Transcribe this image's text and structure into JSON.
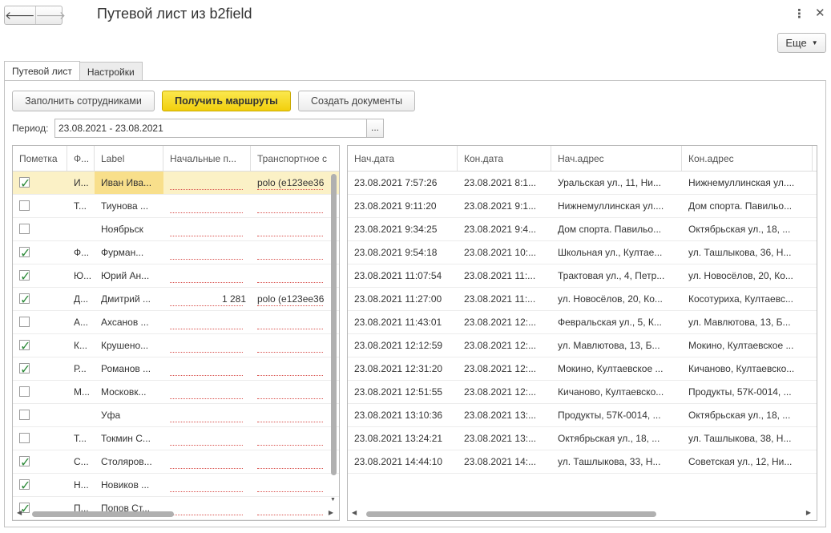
{
  "header": {
    "back_icon": "arrow-left-icon",
    "forward_icon": "arrow-right-icon",
    "title": "Путевой лист из b2field",
    "more_label": "Еще"
  },
  "tabs": [
    {
      "label": "Путевой лист",
      "active": true
    },
    {
      "label": "Настройки",
      "active": false
    }
  ],
  "toolbar": {
    "fill_employees": "Заполнить сотрудниками",
    "get_routes": "Получить маршруты",
    "create_documents": "Создать документы"
  },
  "period": {
    "label": "Период:",
    "value": "23.08.2021 - 23.08.2021",
    "select_label": "..."
  },
  "left_table": {
    "columns": [
      "Пометка",
      "Ф...",
      "Label",
      "Начальные п...",
      "Транспортное с"
    ],
    "rows": [
      {
        "checked": true,
        "f": "И...",
        "label": "Иван Ива...",
        "initial": "",
        "transport": "polo (e123ee36"
      },
      {
        "checked": false,
        "f": "Т...",
        "label": "Тиунова ...",
        "initial": "",
        "transport": ""
      },
      {
        "checked": false,
        "f": "",
        "label": "Ноябрьск",
        "initial": "",
        "transport": ""
      },
      {
        "checked": true,
        "f": "Ф...",
        "label": "Фурман...",
        "initial": "",
        "transport": ""
      },
      {
        "checked": true,
        "f": "Ю...",
        "label": "Юрий Ан...",
        "initial": "",
        "transport": ""
      },
      {
        "checked": true,
        "f": "Д...",
        "label": "Дмитрий ...",
        "initial": "1 281",
        "transport": "polo (e123ee36"
      },
      {
        "checked": false,
        "f": "А...",
        "label": "Ахсанов ...",
        "initial": "",
        "transport": ""
      },
      {
        "checked": true,
        "f": "К...",
        "label": "Крушено...",
        "initial": "",
        "transport": ""
      },
      {
        "checked": true,
        "f": "Р...",
        "label": "Романов ...",
        "initial": "",
        "transport": ""
      },
      {
        "checked": false,
        "f": "М...",
        "label": "Московк...",
        "initial": "",
        "transport": ""
      },
      {
        "checked": false,
        "f": "",
        "label": "Уфа",
        "initial": "",
        "transport": ""
      },
      {
        "checked": false,
        "f": "Т...",
        "label": "Токмин С...",
        "initial": "",
        "transport": ""
      },
      {
        "checked": true,
        "f": "С...",
        "label": "Столяров...",
        "initial": "",
        "transport": ""
      },
      {
        "checked": true,
        "f": "Н...",
        "label": "Новиков ...",
        "initial": "",
        "transport": ""
      },
      {
        "checked": true,
        "f": "П...",
        "label": "Попов Ст...",
        "initial": "",
        "transport": ""
      }
    ]
  },
  "right_table": {
    "columns": [
      "Нач.дата",
      "Кон.дата",
      "Нач.адрес",
      "Кон.адрес"
    ],
    "rows": [
      [
        "23.08.2021 7:57:26",
        "23.08.2021 8:1...",
        "Уральская ул., 11, Ни...",
        "Нижнемуллинская ул...."
      ],
      [
        "23.08.2021 9:11:20",
        "23.08.2021 9:1...",
        "Нижнемуллинская ул....",
        "Дом спорта. Павильо..."
      ],
      [
        "23.08.2021 9:34:25",
        "23.08.2021 9:4...",
        "Дом спорта. Павильо...",
        "Октябрьская ул., 18, ..."
      ],
      [
        "23.08.2021 9:54:18",
        "23.08.2021 10:...",
        "Школьная ул., Култае...",
        "ул. Ташлыкова, 36, Н..."
      ],
      [
        "23.08.2021 11:07:54",
        "23.08.2021 11:...",
        "Трактовая ул., 4, Петр...",
        "ул. Новосёлов, 20, Ко..."
      ],
      [
        "23.08.2021 11:27:00",
        "23.08.2021 11:...",
        "ул. Новосёлов, 20, Ко...",
        "Косотуриха, Култаевс..."
      ],
      [
        "23.08.2021 11:43:01",
        "23.08.2021 12:...",
        "Февральская ул., 5, К...",
        "ул. Мавлютова, 13, Б..."
      ],
      [
        "23.08.2021 12:12:59",
        "23.08.2021 12:...",
        "ул. Мавлютова, 13, Б...",
        "Мокино, Култаевское ..."
      ],
      [
        "23.08.2021 12:31:20",
        "23.08.2021 12:...",
        "Мокино, Култаевское ...",
        "Кичаново, Култаевско..."
      ],
      [
        "23.08.2021 12:51:55",
        "23.08.2021 12:...",
        "Кичаново, Култаевско...",
        "Продукты, 57К-0014, ..."
      ],
      [
        "23.08.2021 13:10:36",
        "23.08.2021 13:...",
        "Продукты, 57К-0014, ...",
        "Октябрьская ул., 18, ..."
      ],
      [
        "23.08.2021 13:24:21",
        "23.08.2021 13:...",
        "Октябрьская ул., 18, ...",
        "ул. Ташлыкова, 38, Н..."
      ],
      [
        "23.08.2021 14:44:10",
        "23.08.2021 14:...",
        "ул. Ташлыкова, 33, Н...",
        "Советская ул., 12, Ни..."
      ]
    ]
  }
}
